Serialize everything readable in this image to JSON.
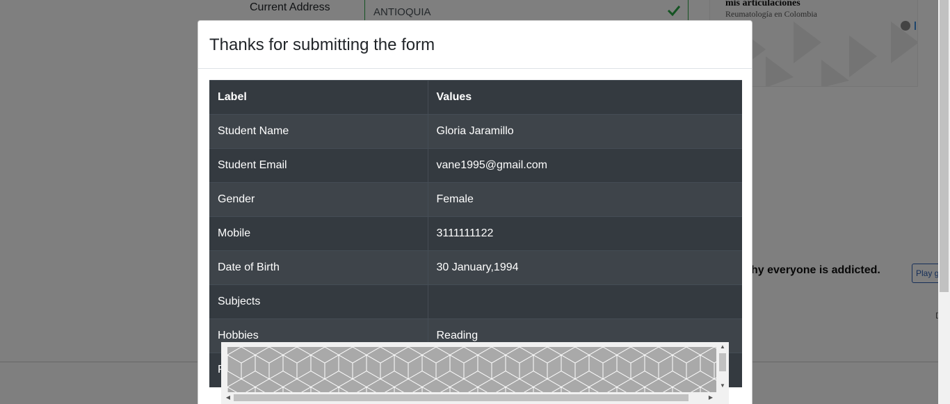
{
  "background": {
    "current_address_label": "Current Address",
    "current_address_value": "ANTIOQUIA",
    "ad_title": "mis articulaciones",
    "ad_subtitle": "Reumatología en Colombia",
    "addicted_text": "hy everyone is addicted.",
    "play_button": "Play g",
    "small_text": "D"
  },
  "modal": {
    "title": "Thanks for submitting the form",
    "table": {
      "headers": [
        "Label",
        "Values"
      ],
      "rows": [
        [
          "Student Name",
          "Gloria Jaramillo"
        ],
        [
          "Student Email",
          "vane1995@gmail.com"
        ],
        [
          "Gender",
          "Female"
        ],
        [
          "Mobile",
          "3111111122"
        ],
        [
          "Date of Birth",
          "30 January,1994"
        ],
        [
          "Subjects",
          ""
        ],
        [
          "Hobbies",
          "Reading"
        ],
        [
          "Pi",
          ""
        ]
      ]
    }
  },
  "colors": {
    "table_dark": "#343a40",
    "table_stripe": "#3e444a",
    "valid_green": "#28a745"
  }
}
